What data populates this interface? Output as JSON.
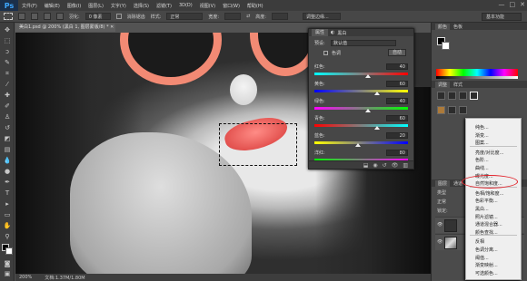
{
  "app": {
    "logo": "Ps"
  },
  "menu": [
    "文件(F)",
    "编辑(E)",
    "图像(I)",
    "图层(L)",
    "文字(Y)",
    "选择(S)",
    "滤镜(T)",
    "3D(D)",
    "视图(V)",
    "窗口(W)",
    "帮助(H)"
  ],
  "window_buttons": [
    "—",
    "□",
    "✕"
  ],
  "options": {
    "feather_label": "羽化:",
    "feather_value": "0 像素",
    "antialias_label": "消除锯齿",
    "style_label": "样式:",
    "style_value": "正常",
    "width_label": "宽度:",
    "height_label": "高度:",
    "refine_edge": "调整边缘...",
    "workspace": "基本功能"
  },
  "doc_tab": "美白1.psd @ 200% (黑白 1, 图层蒙版/8) * ✕",
  "status": {
    "zoom": "200%",
    "doc": "文档:1.37M/1.80M"
  },
  "properties": {
    "tabs": [
      "属性",
      "黑白"
    ],
    "preset_label": "预设:",
    "preset_value": "默认值",
    "tint_label": "色调",
    "auto_button": "自动",
    "sliders": [
      {
        "label": "红色:",
        "value": 40,
        "pct": 0.57,
        "c1": "#00ffff",
        "c2": "#ff0000"
      },
      {
        "label": "黄色:",
        "value": 60,
        "pct": 0.67,
        "c1": "#0000ff",
        "c2": "#ffff00"
      },
      {
        "label": "绿色:",
        "value": 40,
        "pct": 0.57,
        "c1": "#ff00ff",
        "c2": "#00ff00"
      },
      {
        "label": "青色:",
        "value": 60,
        "pct": 0.67,
        "c1": "#ff0000",
        "c2": "#00ffff"
      },
      {
        "label": "蓝色:",
        "value": 20,
        "pct": 0.47,
        "c1": "#ffff00",
        "c2": "#0000ff"
      },
      {
        "label": "洋红:",
        "value": 80,
        "pct": 0.77,
        "c1": "#00ff00",
        "c2": "#ff00ff"
      }
    ]
  },
  "right_panel": {
    "color_tabs": [
      "颜色",
      "色板"
    ],
    "adjust_tabs": [
      "调整",
      "样式"
    ],
    "layer_tabs": [
      "图层",
      "通道",
      "路径"
    ],
    "kind_label": "类型",
    "blend_value": "正常",
    "lock_label": "锁定:",
    "fill_label": "填充:"
  },
  "dropdown": {
    "items": [
      "纯色...",
      "渐变...",
      "图案...",
      "亮度/对比度...",
      "色阶...",
      "曲线...",
      "曝光度...",
      "自然饱和度...",
      "色相/饱和度...",
      "色彩平衡...",
      "黑白...",
      "照片滤镜...",
      "通道混合器...",
      "颜色查找...",
      "反相",
      "色调分离...",
      "阈值...",
      "渐变映射...",
      "可选颜色..."
    ],
    "highlighted": "色相/饱和度..."
  },
  "colors": {
    "accent": "#e2222a",
    "lips": "#e3524f",
    "frames": "#f28a74"
  }
}
